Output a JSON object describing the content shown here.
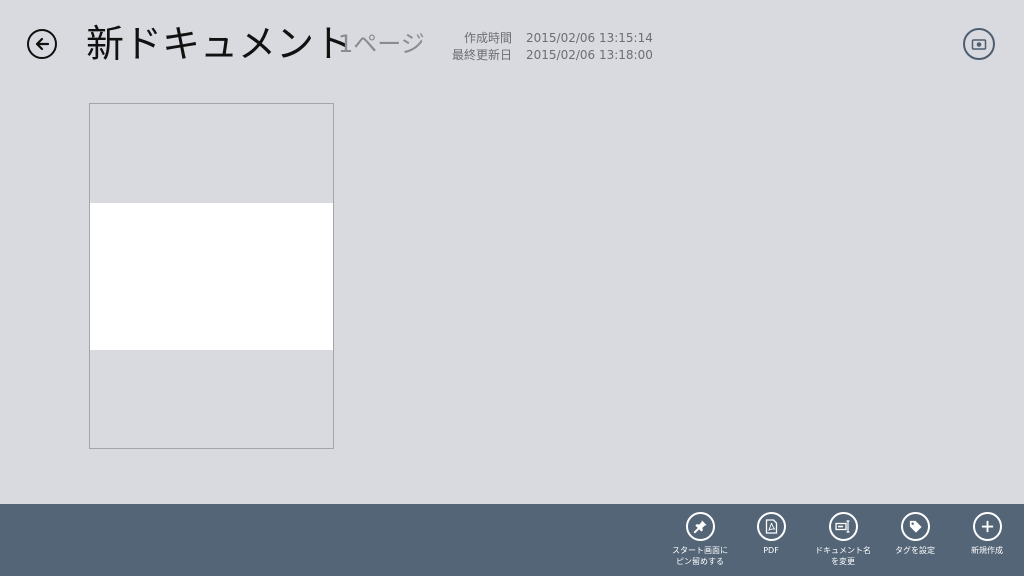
{
  "header": {
    "title": "新ドキュメント",
    "page_count": "1ページ",
    "created_label": "作成時間",
    "created_value": "2015/02/06 13:15:14",
    "modified_label": "最終更新日",
    "modified_value": "2015/02/06 13:18:00"
  },
  "icons": {
    "back": "arrow-left-icon",
    "camera": "camera-icon",
    "pin": "pin-icon",
    "pdf": "pdf-icon",
    "rename": "rename-icon",
    "tag": "tag-icon",
    "add": "plus-icon"
  },
  "colors": {
    "background": "#d9dadf",
    "appbar": "#536577",
    "page_white": "#ffffff"
  },
  "appbar": {
    "pin_label": "スタート画面に\nピン留めする",
    "pdf_label": "PDF",
    "rename_label": "ドキュメント名\nを変更",
    "tag_label": "タグを設定",
    "new_label": "新規作成"
  }
}
